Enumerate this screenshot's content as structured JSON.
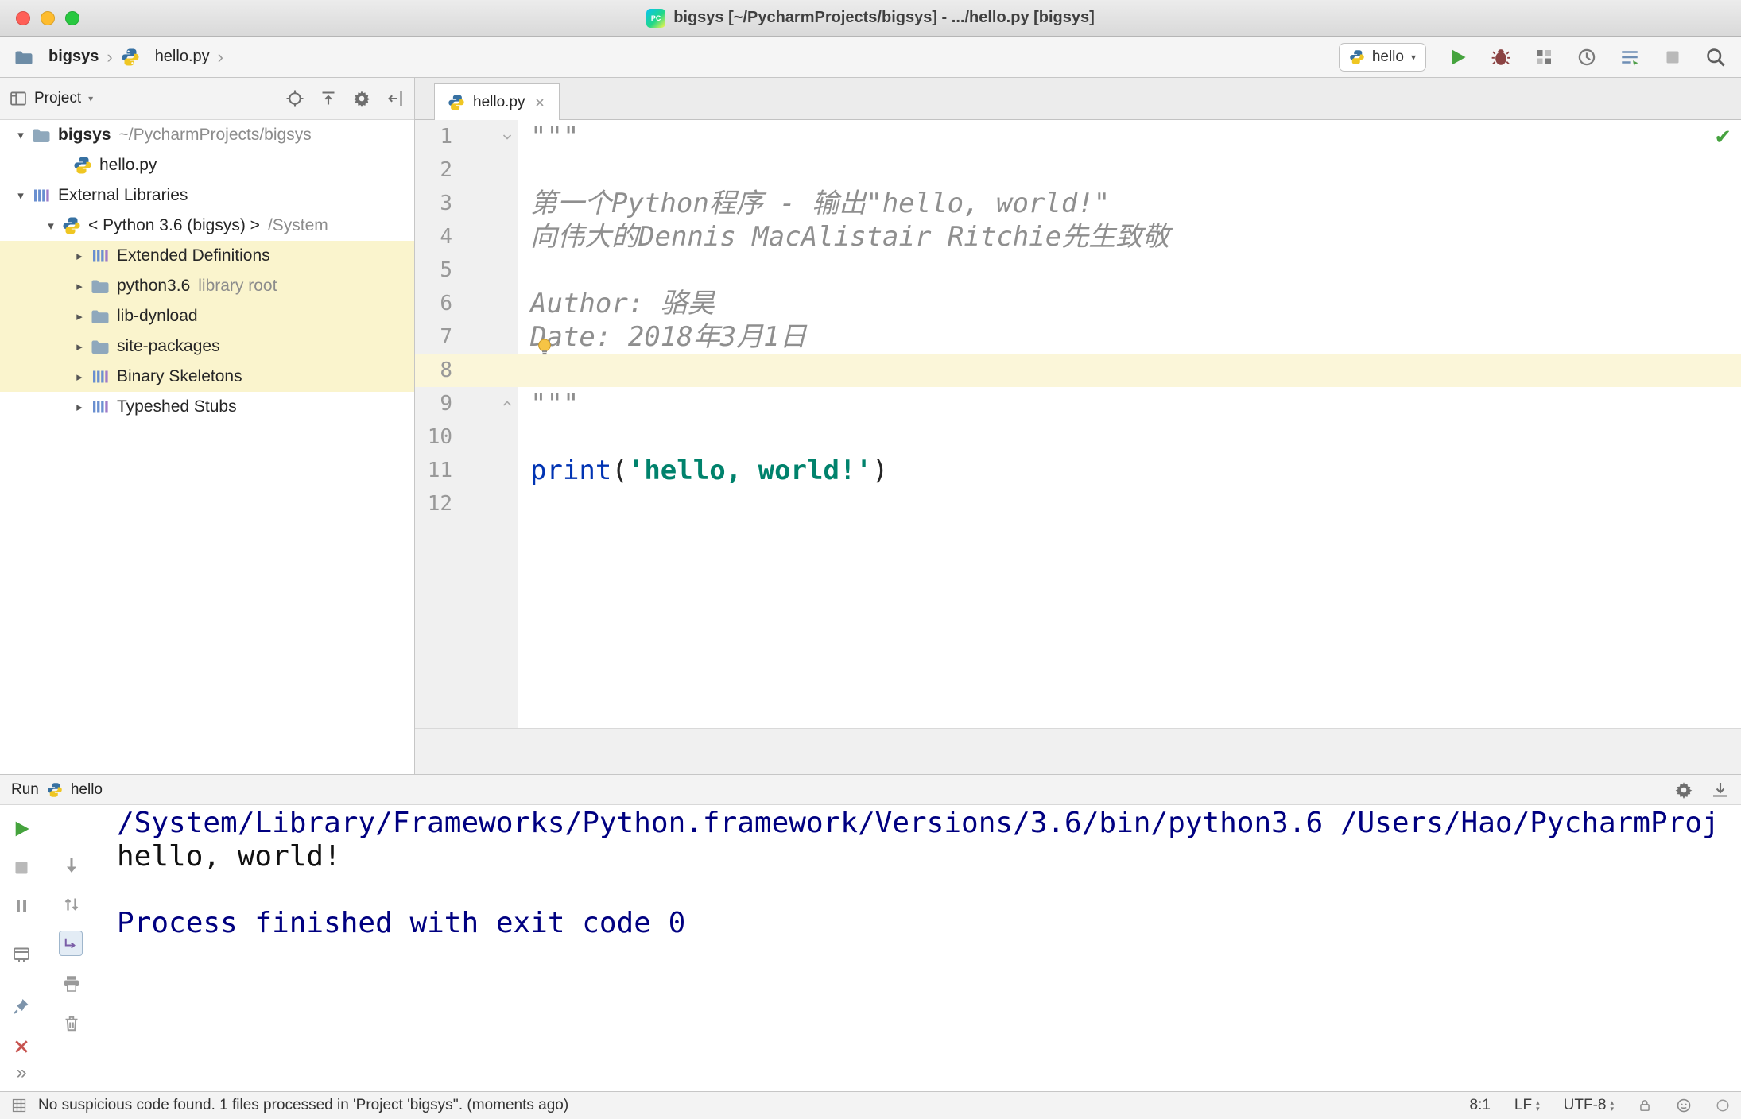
{
  "window": {
    "title": "bigsys [~/PycharmProjects/bigsys] - .../hello.py [bigsys]"
  },
  "navbar": {
    "breadcrumb_project": "bigsys",
    "breadcrumb_file": "hello.py",
    "run_config": "hello"
  },
  "project_panel": {
    "title": "Project",
    "tree": [
      {
        "label": "bigsys",
        "detail": "~/PycharmProjects/bigsys"
      },
      {
        "label": "hello.py"
      },
      {
        "label": "External Libraries"
      },
      {
        "label": "< Python 3.6 (bigsys) >",
        "detail": "/System"
      },
      {
        "label": "Extended Definitions"
      },
      {
        "label": "python3.6",
        "detail": "library root"
      },
      {
        "label": "lib-dynload"
      },
      {
        "label": "site-packages"
      },
      {
        "label": "Binary Skeletons"
      },
      {
        "label": "Typeshed Stubs"
      }
    ]
  },
  "editor": {
    "tab_label": "hello.py",
    "line_numbers": [
      "1",
      "2",
      "3",
      "4",
      "5",
      "6",
      "7",
      "8",
      "9",
      "10",
      "11",
      "12"
    ],
    "code": {
      "l1": "\"\"\"",
      "l3": "第一个Python程序 - 输出\"hello, world!\"",
      "l4": "向伟大的Dennis MacAlistair Ritchie先生致敬",
      "l6": "Author: 骆昊",
      "l7": "Date: 2018年3月1日",
      "l9": "\"\"\"",
      "l11_fn": "print",
      "l11_p1": "(",
      "l11_str": "'hello, world!'",
      "l11_p2": ")"
    }
  },
  "run_panel": {
    "title": "Run",
    "config": "hello",
    "console": [
      "/System/Library/Frameworks/Python.framework/Versions/3.6/bin/python3.6 /Users/Hao/PycharmProj",
      "hello, world!",
      "",
      "Process finished with exit code 0"
    ]
  },
  "statusbar": {
    "message": "No suspicious code found. 1 files processed in 'Project 'bigsys''. (moments ago)",
    "caret_position": "8:1",
    "line_separator": "LF",
    "encoding": "UTF-8"
  }
}
